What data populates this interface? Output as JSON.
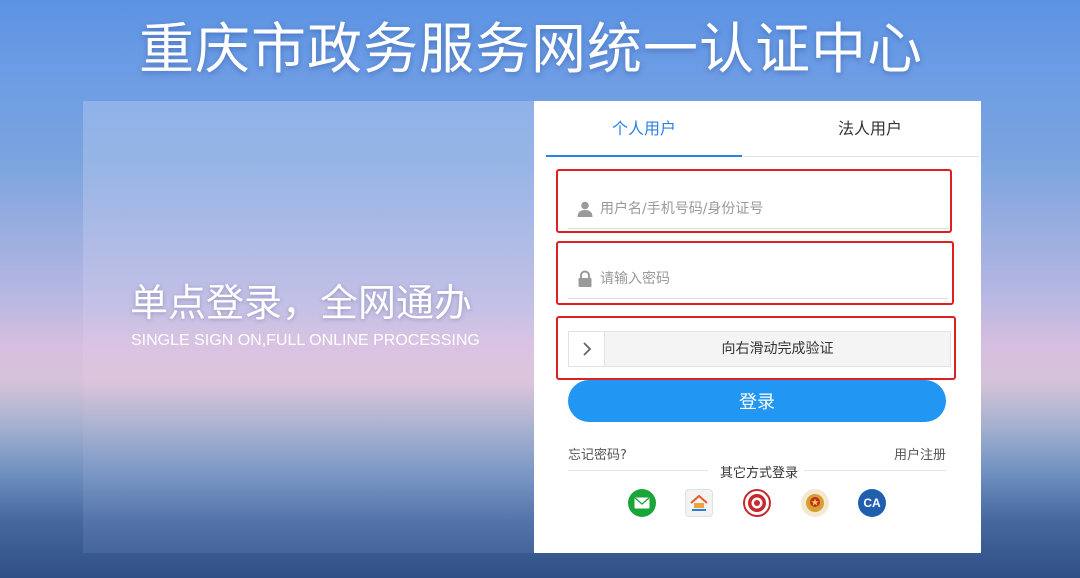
{
  "header": {
    "title": "重庆市政务服务网统一认证中心"
  },
  "hero": {
    "slogan": "单点登录，全网通办",
    "slogan_en": "SINGLE SIGN ON,FULL ONLINE PROCESSING"
  },
  "login": {
    "tabs": [
      {
        "label": "个人用户",
        "active": true
      },
      {
        "label": "法人用户",
        "active": false
      }
    ],
    "username": {
      "placeholder": "用户名/手机号码/身份证号",
      "value": "",
      "icon": "user-icon"
    },
    "password": {
      "placeholder": "请输入密码",
      "value": "",
      "icon": "lock-icon"
    },
    "slider": {
      "text": "向右滑动完成验证",
      "icon": "chevron-right-icon"
    },
    "submit_label": "登录",
    "forgot_password": "忘记密码?",
    "register": "用户注册",
    "other_methods_label": "其它方式登录",
    "other_methods": [
      {
        "icon": "wechat-icon",
        "color": "#1aa53a"
      },
      {
        "icon": "cq-app-icon",
        "color": "#f3f3f3"
      },
      {
        "icon": "seal-icon",
        "color": "#c8282d"
      },
      {
        "icon": "national-emblem-icon",
        "color": "#f5e8d0"
      },
      {
        "icon": "ca-icon",
        "label": "CA",
        "color": "#1f5fae"
      }
    ]
  },
  "colors": {
    "accent": "#2a82e4",
    "button": "#2196f3",
    "highlight_box": "#e02020"
  }
}
